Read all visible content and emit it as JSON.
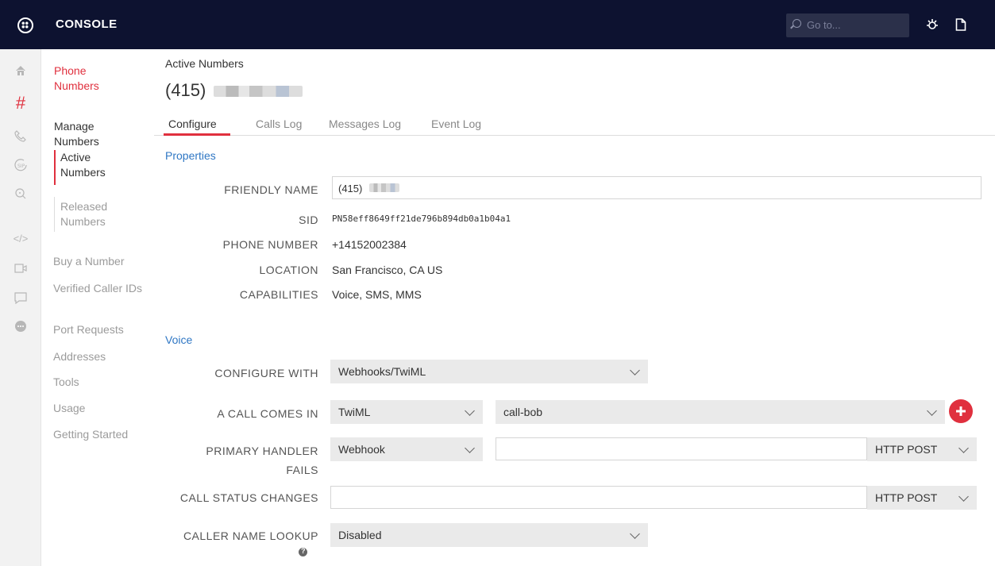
{
  "topbar": {
    "brand": "CONSOLE",
    "search_placeholder": "Go to..."
  },
  "rail": {
    "icons": [
      "home-icon",
      "hash-icon",
      "phone-icon",
      "sip-icon",
      "search-icon",
      "code-icon",
      "video-icon",
      "chat-icon",
      "more-icon"
    ]
  },
  "nav": {
    "section": "Phone Numbers",
    "manage": "Manage Numbers",
    "active": "Active Numbers",
    "released": "Released Numbers",
    "buy": "Buy a Number",
    "verified": "Verified Caller IDs",
    "port": "Port Requests",
    "addresses": "Addresses",
    "tools": "Tools",
    "usage": "Usage",
    "getting_started": "Getting Started"
  },
  "header": {
    "breadcrumb": "Active Numbers",
    "title_prefix": "(415)"
  },
  "tabs": [
    "Configure",
    "Calls Log",
    "Messages Log",
    "Event Log"
  ],
  "properties": {
    "heading": "Properties",
    "friendly_name_label": "FRIENDLY NAME",
    "friendly_name_prefix": "(415)",
    "sid_label": "SID",
    "sid": "PN58eff8649ff21de796b894db0a1b04a1",
    "phone_label": "PHONE NUMBER",
    "phone": "+14152002384",
    "location_label": "LOCATION",
    "location": "San Francisco, CA US",
    "capabilities_label": "CAPABILITIES",
    "capabilities": "Voice, SMS, MMS"
  },
  "voice": {
    "heading": "Voice",
    "configure_with_label": "CONFIGURE WITH",
    "configure_with": "Webhooks/TwiML",
    "call_comes_in_label": "A CALL COMES IN",
    "call_type": "TwiML",
    "call_target": "call-bob",
    "primary_fail_label_1": "PRIMARY HANDLER",
    "primary_fail_label_2": "FAILS",
    "primary_fail_type": "Webhook",
    "primary_method": "HTTP POST",
    "status_label": "CALL STATUS CHANGES",
    "status_method": "HTTP POST",
    "lookup_label": "CALLER NAME LOOKUP",
    "lookup_value": "Disabled"
  },
  "colors": {
    "topbar": "#0d1230",
    "accent_red": "#e0303e",
    "link_blue": "#2f77c4"
  }
}
